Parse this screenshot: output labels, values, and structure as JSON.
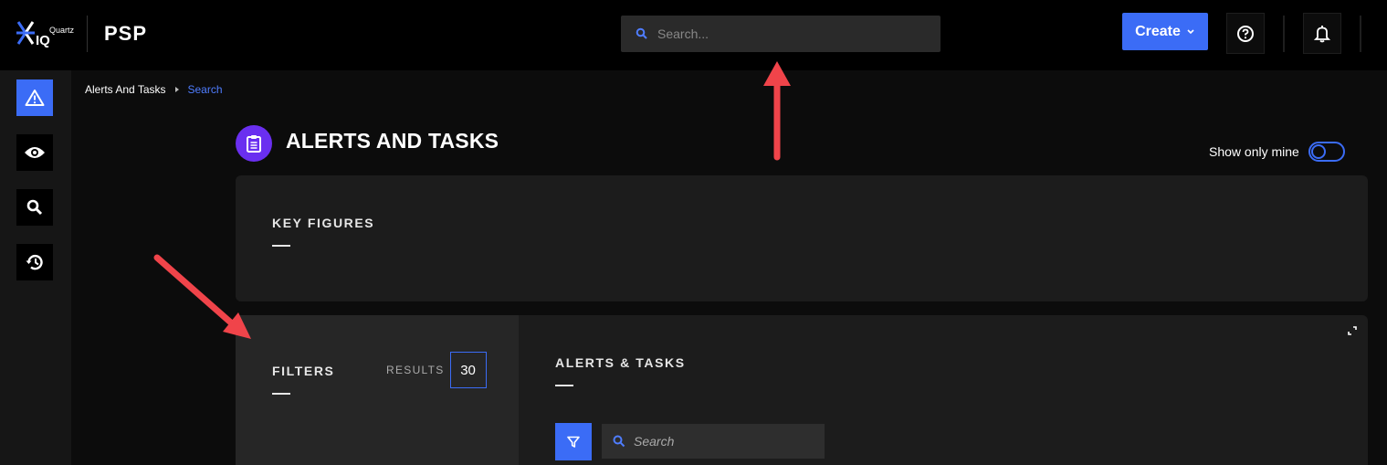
{
  "header": {
    "logo_small": "Quartz",
    "logo_big": "IQ",
    "app_name": "PSP",
    "search_placeholder": "Search...",
    "create_label": "Create"
  },
  "sidebar": {
    "items": [
      {
        "icon": "warning-icon",
        "active": true
      },
      {
        "icon": "eye-icon",
        "active": false
      },
      {
        "icon": "search-icon",
        "active": false
      },
      {
        "icon": "history-icon",
        "active": false
      }
    ]
  },
  "breadcrumb": {
    "parent": "Alerts And Tasks",
    "current": "Search"
  },
  "page": {
    "title": "ALERTS AND TASKS",
    "show_only_mine_label": "Show only mine"
  },
  "key_figures": {
    "heading": "KEY FIGURES"
  },
  "filters": {
    "heading": "FILTERS",
    "results_label": "RESULTS",
    "results_count": "30"
  },
  "alerts_tasks": {
    "heading": "ALERTS & TASKS",
    "search_placeholder": "Search"
  },
  "colors": {
    "accent": "#3b6cf6",
    "page_icon": "#6a2ff0",
    "annotation_arrow": "#f0444a"
  }
}
